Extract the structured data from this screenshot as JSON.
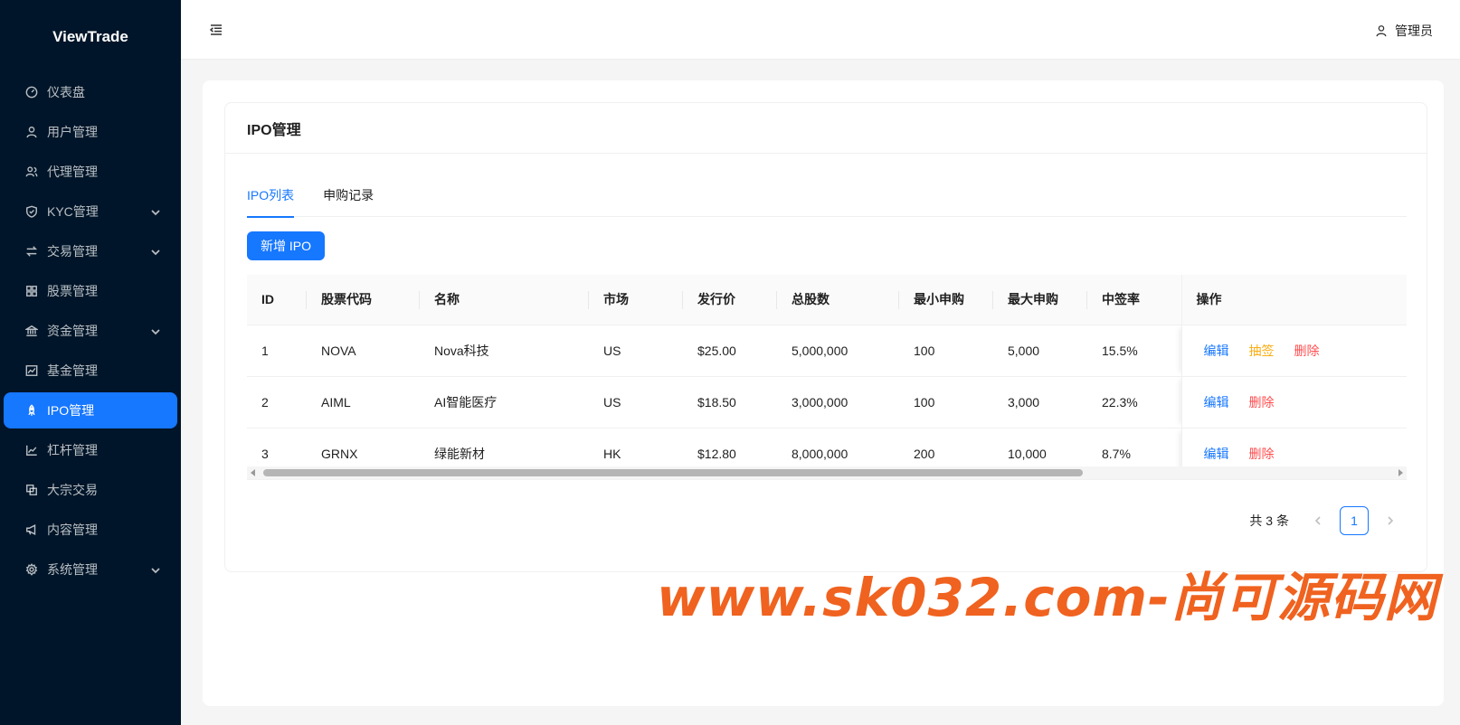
{
  "app": {
    "logo": "ViewTrade"
  },
  "sidebar": {
    "items": [
      {
        "label": "仪表盘",
        "icon": "dashboard-icon"
      },
      {
        "label": "用户管理",
        "icon": "user-icon"
      },
      {
        "label": "代理管理",
        "icon": "team-icon"
      },
      {
        "label": "KYC管理",
        "icon": "shield-check-icon",
        "expandable": true
      },
      {
        "label": "交易管理",
        "icon": "swap-icon",
        "expandable": true
      },
      {
        "label": "股票管理",
        "icon": "grid-icon"
      },
      {
        "label": "资金管理",
        "icon": "bank-icon",
        "expandable": true
      },
      {
        "label": "基金管理",
        "icon": "line-chart-icon"
      },
      {
        "label": "IPO管理",
        "icon": "rocket-icon",
        "active": true
      },
      {
        "label": "杠杆管理",
        "icon": "stock-icon"
      },
      {
        "label": "大宗交易",
        "icon": "block-icon"
      },
      {
        "label": "内容管理",
        "icon": "notification-icon"
      },
      {
        "label": "系统管理",
        "icon": "setting-icon",
        "expandable": true
      }
    ]
  },
  "header": {
    "user": "管理员"
  },
  "card": {
    "title": "IPO管理"
  },
  "tabs": [
    {
      "label": "IPO列表",
      "active": true
    },
    {
      "label": "申购记录"
    }
  ],
  "toolbar": {
    "add_label": "新增 IPO"
  },
  "table": {
    "columns": [
      "ID",
      "股票代码",
      "名称",
      "市场",
      "发行价",
      "总股数",
      "最小申购",
      "最大申购",
      "中签率",
      "操作"
    ],
    "rows": [
      {
        "id": "1",
        "code": "NOVA",
        "name": "Nova科技",
        "market": "US",
        "price": "$25.00",
        "shares": "5,000,000",
        "min": "100",
        "max": "5,000",
        "rate": "15.5%",
        "actions": [
          "编辑",
          "抽签",
          "删除"
        ]
      },
      {
        "id": "2",
        "code": "AIML",
        "name": "AI智能医疗",
        "market": "US",
        "price": "$18.50",
        "shares": "3,000,000",
        "min": "100",
        "max": "3,000",
        "rate": "22.3%",
        "actions": [
          "编辑",
          "删除"
        ]
      },
      {
        "id": "3",
        "code": "GRNX",
        "name": "绿能新材",
        "market": "HK",
        "price": "$12.80",
        "shares": "8,000,000",
        "min": "200",
        "max": "10,000",
        "rate": "8.7%",
        "actions": [
          "编辑",
          "删除"
        ]
      }
    ]
  },
  "pagination": {
    "total": "共 3 条",
    "current": "1"
  },
  "watermark": "www.sk032.com-尚可源码网",
  "colors": {
    "sidebar_bg": "#001529",
    "primary": "#1677ff",
    "warning": "#faad14",
    "danger": "#ff4d4f",
    "watermark": "#f0621f"
  }
}
